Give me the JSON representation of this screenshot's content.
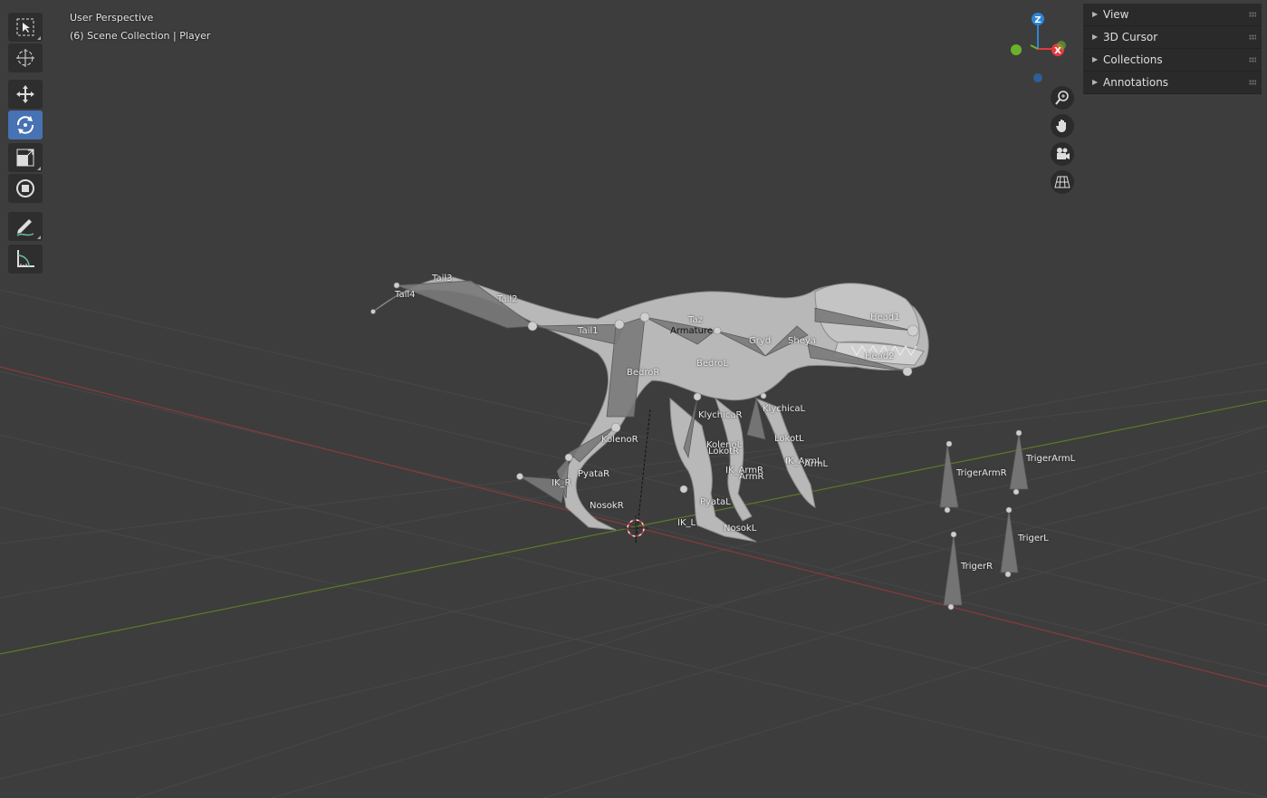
{
  "header": {
    "view_name": "User Perspective",
    "collection": "(6) Scene Collection | Player"
  },
  "toolbar": {
    "tools": [
      {
        "name": "select-box-tool",
        "icon": "select-box-icon",
        "active": false
      },
      {
        "name": "cursor-tool",
        "icon": "cursor-icon",
        "active": false
      },
      {
        "name": "move-tool",
        "icon": "move-icon",
        "active": false
      },
      {
        "name": "rotate-tool",
        "icon": "rotate-icon",
        "active": true
      },
      {
        "name": "scale-tool",
        "icon": "scale-icon",
        "active": false
      },
      {
        "name": "transform-tool",
        "icon": "transform-icon",
        "active": false
      },
      {
        "name": "annotate-tool",
        "icon": "annotate-icon",
        "active": false
      },
      {
        "name": "measure-tool",
        "icon": "measure-icon",
        "active": false
      }
    ]
  },
  "gizmo": {
    "z_label": "Z",
    "x_label": "X",
    "colors": {
      "x": "#e33a3f",
      "y": "#6bb22c",
      "z": "#2e84d6"
    }
  },
  "nav_buttons": [
    "zoom-icon",
    "hand-pan-icon",
    "camera-icon",
    "ortho-grid-icon"
  ],
  "sidebar": {
    "panels": [
      {
        "label": "View"
      },
      {
        "label": "3D Cursor"
      },
      {
        "label": "Collections"
      },
      {
        "label": "Annotations"
      }
    ]
  },
  "scene": {
    "armature_label": "Armature",
    "bones": [
      "Tail4",
      "Tail3",
      "Tail2",
      "Tail1",
      "Taz",
      "Gryd",
      "Sheya",
      "Head1",
      "Head2",
      "BedroR",
      "BedroL",
      "KlychicaR",
      "KlychicaL",
      "KolenoR",
      "KolenoL",
      "LokotR",
      "LokotL",
      "PyataR",
      "PyataL",
      "IK_R",
      "IK_L",
      "IK_ArmR",
      "ArmR",
      "IK_ArmL",
      "ArmL",
      "NosokR",
      "NosokL",
      "TrigerArmR",
      "TrigerArmL",
      "TrigerL",
      "TrigerR"
    ]
  }
}
